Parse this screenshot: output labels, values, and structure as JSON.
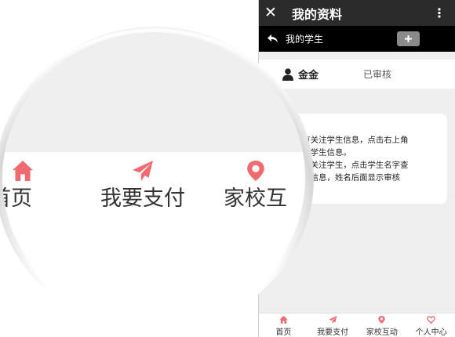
{
  "phone": {
    "header": {
      "close_icon": "close-icon",
      "title": "我的资料",
      "more_icon": "more-vertical-icon"
    },
    "subbar": {
      "back_icon": "reply-arrow-icon",
      "title": "我的学生",
      "add_label": "+"
    },
    "student": {
      "name": "金金",
      "status": "已审核"
    },
    "notice": {
      "lines": [
        "没有关注学生信息，点击右上角",
        "关注学生信息。",
        "已经关注学生，点击学生名字查",
        "详细信息，姓名后面显示审核"
      ]
    },
    "tabbar": {
      "items": [
        {
          "label": "首页",
          "icon": "home-icon"
        },
        {
          "label": "我要支付",
          "icon": "paper-plane-icon"
        },
        {
          "label": "家校互动",
          "icon": "location-pin-icon"
        },
        {
          "label": "个人中心",
          "icon": "heart-icon"
        }
      ]
    }
  },
  "magnifier": {
    "labels": [
      "首页",
      "我要支付",
      "家校互"
    ]
  },
  "colors": {
    "accent": "#f06a6f",
    "titlebar": "#2b2b2b",
    "subbar": "#000000"
  }
}
